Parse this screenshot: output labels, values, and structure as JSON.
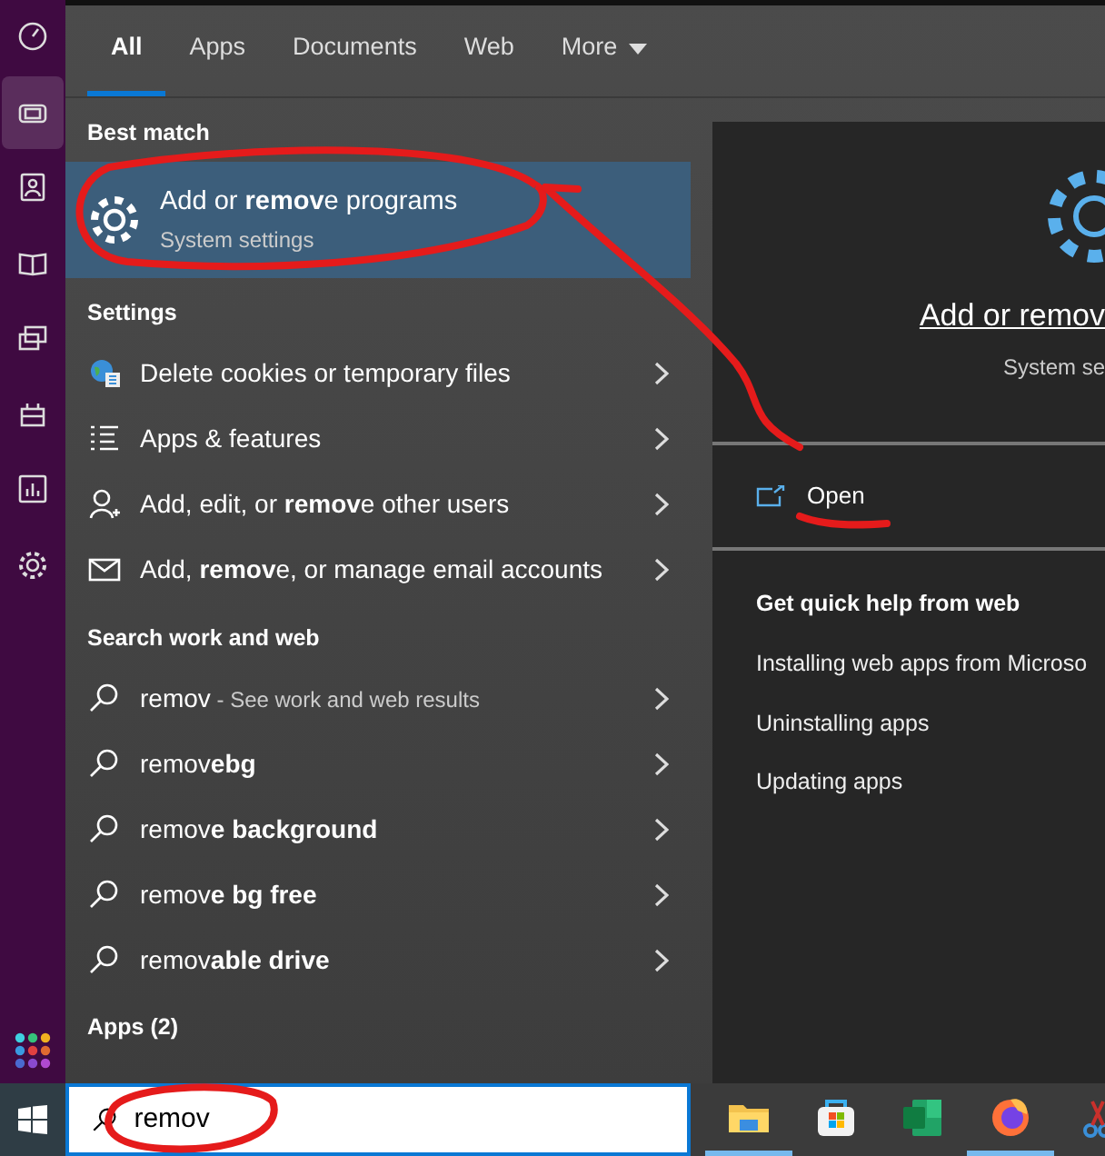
{
  "sidebar": {
    "items": [
      {
        "selected": false
      },
      {
        "selected": true
      },
      {
        "selected": false
      },
      {
        "selected": false
      },
      {
        "selected": false
      },
      {
        "selected": false
      },
      {
        "selected": false
      },
      {
        "selected": false
      }
    ]
  },
  "tabs": [
    {
      "label": "All",
      "selected": true
    },
    {
      "label": "Apps",
      "selected": false
    },
    {
      "label": "Documents",
      "selected": false
    },
    {
      "label": "Web",
      "selected": false
    },
    {
      "label": "More",
      "selected": false,
      "dropdown": true
    }
  ],
  "best_match": {
    "heading": "Best match",
    "title": "Add or **remov**e programs",
    "subtitle": "System settings",
    "selected": true
  },
  "settings": {
    "heading": "Settings",
    "items": [
      {
        "label": "Delete cookies or temporary files"
      },
      {
        "label": "Apps & features"
      },
      {
        "label": "Add, edit, or **remov**e other users"
      },
      {
        "label": "Add, **remov**e, or manage email accounts"
      }
    ]
  },
  "web_search": {
    "heading": "Search work and web",
    "items": [
      {
        "label": "remov",
        "hint": " - See work and web results"
      },
      {
        "label": "remov**ebg**"
      },
      {
        "label": "remov**e background**"
      },
      {
        "label": "remov**e bg free**"
      },
      {
        "label": "remov**able drive**"
      }
    ]
  },
  "apps_heading": "Apps (2)",
  "preview": {
    "title": "Add or remov",
    "subtitle": "System se",
    "action": "Open",
    "help_heading": "Get quick help from web",
    "help_links": [
      "Installing web apps from Microso",
      "Uninstalling apps",
      "Updating apps"
    ]
  },
  "search_box": {
    "value": "remov"
  },
  "taskbar": {
    "apps": [
      {
        "running": true
      },
      {
        "running": false
      },
      {
        "running": false
      },
      {
        "running": true
      },
      {
        "running": false
      }
    ]
  }
}
